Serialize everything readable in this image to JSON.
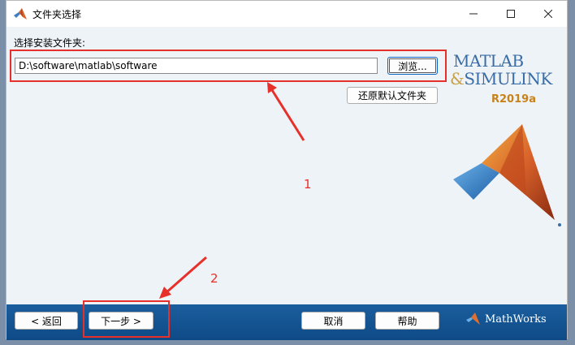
{
  "window": {
    "title": "文件夹选择"
  },
  "form": {
    "folder_label": "选择安装文件夹:",
    "path_value": "D:\\software\\matlab\\software",
    "browse_label": "浏览...",
    "restore_default_label": "还原默认文件夹"
  },
  "logo": {
    "matlab": "MATLAB",
    "amp": "&",
    "simulink": "SIMULINK",
    "version": "R2019a"
  },
  "annotations": {
    "marker1": "1",
    "marker2": "2"
  },
  "footer": {
    "back_label": "< 返回",
    "next_label": "下一步 >",
    "cancel_label": "取消",
    "help_label": "帮助",
    "brand": "MathWorks"
  },
  "colors": {
    "highlight_red": "#e8302a",
    "footer_blue": "#1b5e9e",
    "logo_blue": "#3a6da6",
    "version_orange": "#c8821a"
  }
}
